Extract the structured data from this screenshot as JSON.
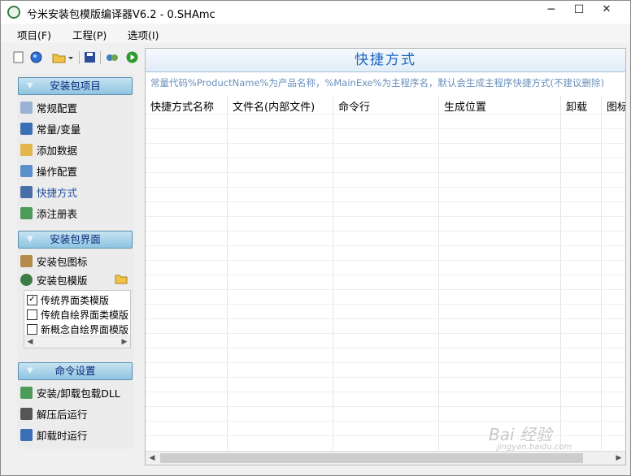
{
  "window": {
    "title": "兮米安装包模版编译器V6.2 - 0.SHAmc",
    "buttons": {
      "minimize": "─",
      "maximize": "☐",
      "close": "✕"
    }
  },
  "menu": [
    "项目(F)",
    "工程(P)",
    "选项(I)"
  ],
  "toolbar": [
    "new-file-icon",
    "open-globe-icon",
    "folder-open-icon",
    "save-icon",
    "settings-icon",
    "run-icon"
  ],
  "sidebar": {
    "group1": {
      "header": "安装包项目",
      "items": [
        "常规配置",
        "常量/变量",
        "添加数据",
        "操作配置",
        "快捷方式",
        "添注册表"
      ],
      "active_index": 4
    },
    "group2": {
      "header": "安装包界面",
      "items": [
        "安装包图标",
        "安装包模版"
      ],
      "templates": [
        {
          "label": "传统界面类模版",
          "checked": true
        },
        {
          "label": "传统自绘界面类模版",
          "checked": false
        },
        {
          "label": "新概念自绘界面模版",
          "checked": false
        }
      ]
    },
    "group3": {
      "header": "命令设置",
      "items": [
        "安装/卸载包载DLL",
        "解压后运行",
        "卸载时运行"
      ]
    }
  },
  "main": {
    "banner": "快捷方式",
    "hint": "常量代码%ProductName%为产品名称，%MainExe%为主程序名，默认会生成主程序快捷方式(不建议删除)",
    "columns": [
      "快捷方式名称",
      "文件名(内部文件)",
      "命令行",
      "生成位置",
      "卸载",
      "图标"
    ]
  },
  "watermark": {
    "top": "Bai 经验",
    "bottom": "jingyan.baidu.com"
  },
  "colors": {
    "banner_text": "#1a64c0",
    "hint_text": "#6a8fbe",
    "header_gradient_top": "#c6e3f2"
  }
}
